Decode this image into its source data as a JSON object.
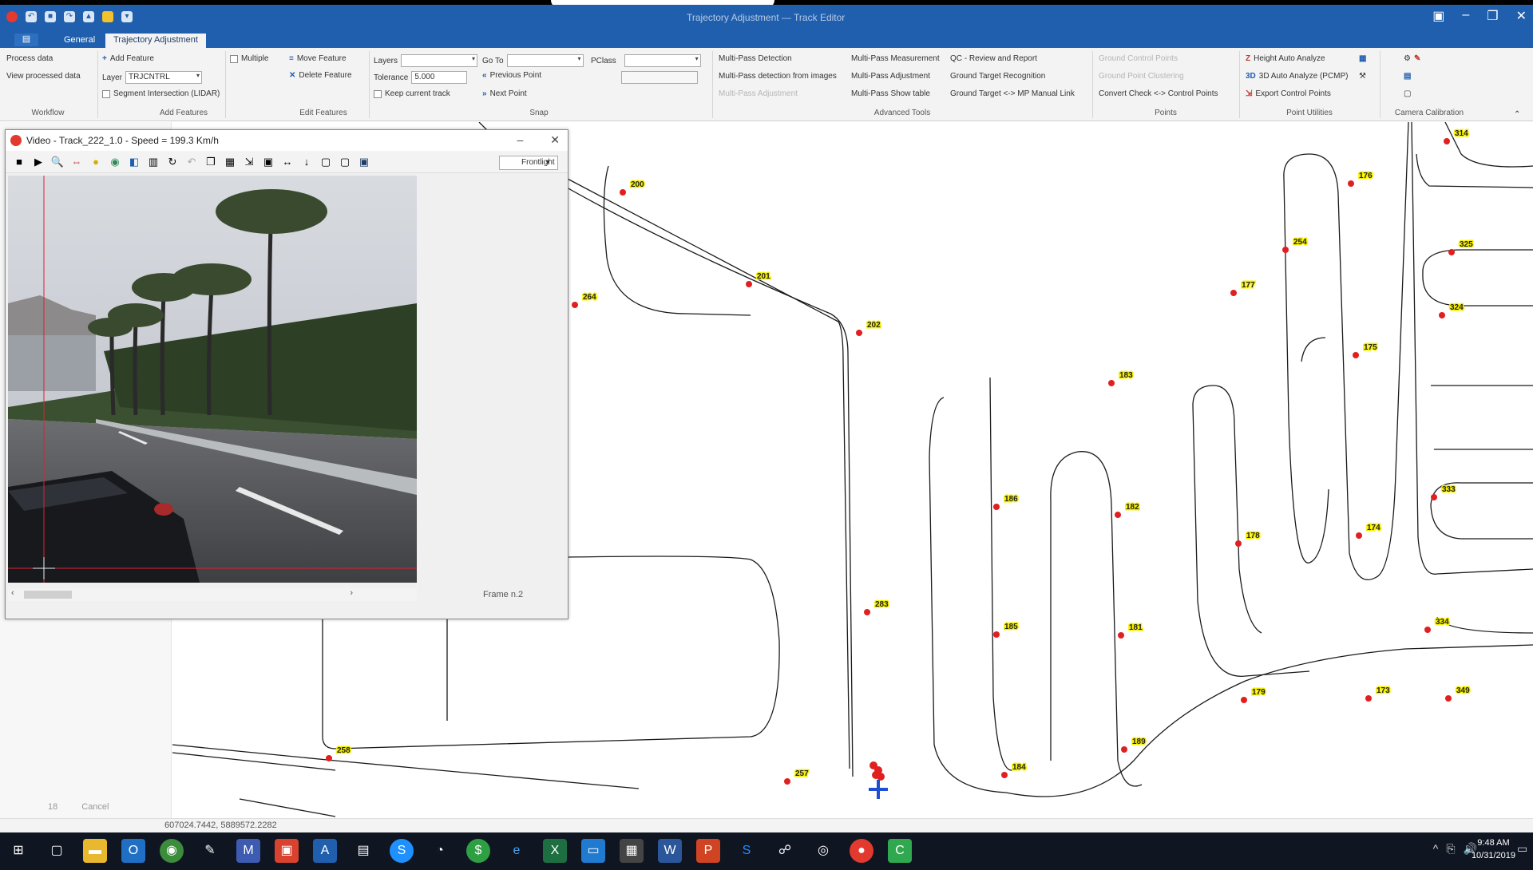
{
  "window": {
    "title": "Trajectory Adjustment — Track Editor"
  },
  "ribbon": {
    "tabs": [
      "General",
      "Trajectory Adjustment"
    ],
    "workflow": {
      "process_data": "Process data",
      "view_processed": "View processed data",
      "group": "Workflow"
    },
    "add_features": {
      "add_feature": "Add Feature",
      "layer_label": "Layer",
      "layer_value": "TRJCNTRL",
      "segment_intersect": "Segment Intersection (LIDAR)",
      "group": "Add Features"
    },
    "edit_features": {
      "multiple": "Multiple",
      "move_feature": "Move Feature",
      "delete_feature": "Delete Feature",
      "group": "Edit Features"
    },
    "snap": {
      "layers_label": "Layers",
      "tolerance_label": "Tolerance",
      "tolerance_value": "5.000",
      "keep_track": "Keep current track",
      "go_to": "Go To",
      "previous_point": "Previous Point",
      "next_point": "Next Point",
      "pclass": "PClass",
      "group": "Snap"
    },
    "advanced_tools": {
      "mp_detection": "Multi-Pass Detection",
      "mp_detection_images": "Multi-Pass detection from images",
      "mp_disabled": "Multi-Pass Adjustment",
      "mp_measurement": "Multi-Pass Measurement",
      "mp_adjustment": "Multi-Pass Adjustment",
      "mp_show": "Multi-Pass Show table",
      "group": "Advanced Tools"
    },
    "points": {
      "qc_review": "QC - Review and Report",
      "ground_target": "Ground Target Recognition",
      "ground_target_mp": "Ground Target <-> MP Manual Link",
      "control_disabled1": "Ground Control Points",
      "control_disabled2": "Ground Point Clustering",
      "convert_check": "Convert Check <-> Control Points",
      "group": "Points"
    },
    "point_utilities": {
      "height_auto": "Height Auto Analyze",
      "auto_analyze": "3D Auto Analyze (PCMP)",
      "export_control": "Export Control Points",
      "group": "Point Utilities"
    },
    "camera_calibration": {
      "group": "Camera Calibration"
    }
  },
  "video_window": {
    "title": "Video - Track_222_1.0 - Speed = 199.3 Km/h",
    "camera_select": "Frontlight",
    "frame_label": "Frame n.2"
  },
  "map": {
    "points": [
      "314",
      "176",
      "325",
      "254",
      "177",
      "324",
      "175",
      "200",
      "264",
      "201",
      "202",
      "183",
      "186",
      "182",
      "178",
      "174",
      "333",
      "283",
      "185",
      "181",
      "334",
      "173",
      "179",
      "349",
      "258",
      "184",
      "257",
      "189"
    ]
  },
  "left_pane": {
    "status_items": [
      "18",
      "Cancel"
    ]
  },
  "status_bar": {
    "coords": "607024.7442, 5889572.2282"
  },
  "taskbar": {
    "time": "9:48 AM",
    "date": "10/31/2019"
  },
  "colors": {
    "titlebar": "#1f5fae",
    "point": "#e02020",
    "label_bg": "#f6f000",
    "cursor": "#1f4fd0"
  }
}
